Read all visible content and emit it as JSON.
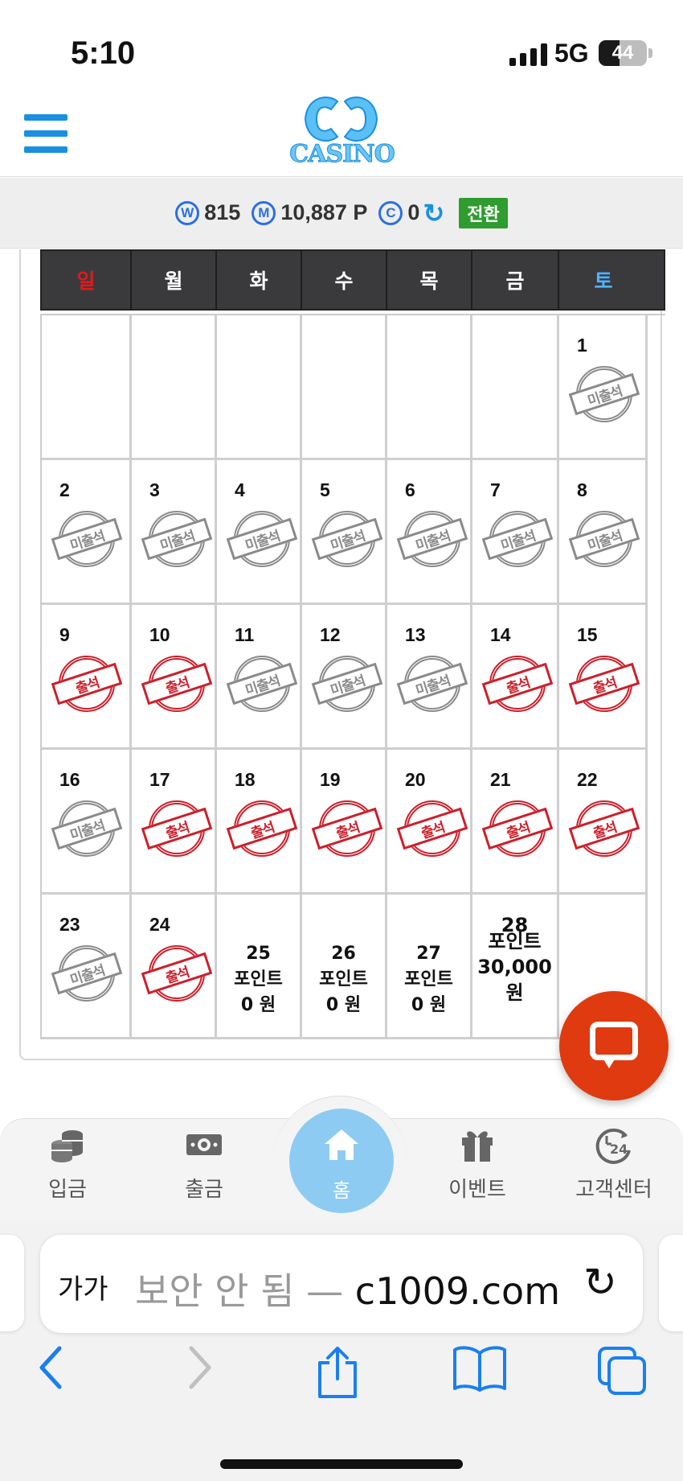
{
  "status_bar": {
    "time": "5:10",
    "network": "5G",
    "battery": "44",
    "battery_level": 0.44
  },
  "header": {
    "logo_text": "CASINO",
    "menu_icon": "hamburger-icon"
  },
  "balance": {
    "cash": "815",
    "mileage": "10,887 P",
    "coin": "0",
    "switch_label": "전환",
    "cash_icon": "W",
    "mileage_icon": "M",
    "coin_icon": "C"
  },
  "calendar": {
    "weekdays": [
      "일",
      "월",
      "화",
      "수",
      "목",
      "금",
      "토"
    ],
    "weekday_colors": [
      "#e01a1a",
      "#ffffff",
      "#ffffff",
      "#ffffff",
      "#ffffff",
      "#ffffff",
      "#4fb3ff"
    ],
    "stamp_absent": "미출석",
    "stamp_present": "출석",
    "points_label": "포인트",
    "days": [
      {
        "day": "",
        "status": ""
      },
      {
        "day": "",
        "status": ""
      },
      {
        "day": "",
        "status": ""
      },
      {
        "day": "",
        "status": ""
      },
      {
        "day": "",
        "status": ""
      },
      {
        "day": "",
        "status": ""
      },
      {
        "day": "1",
        "status": "absent"
      },
      {
        "day": "2",
        "status": "absent"
      },
      {
        "day": "3",
        "status": "absent"
      },
      {
        "day": "4",
        "status": "absent"
      },
      {
        "day": "5",
        "status": "absent"
      },
      {
        "day": "6",
        "status": "absent"
      },
      {
        "day": "7",
        "status": "absent"
      },
      {
        "day": "8",
        "status": "absent"
      },
      {
        "day": "9",
        "status": "present"
      },
      {
        "day": "10",
        "status": "present"
      },
      {
        "day": "11",
        "status": "absent"
      },
      {
        "day": "12",
        "status": "absent"
      },
      {
        "day": "13",
        "status": "absent"
      },
      {
        "day": "14",
        "status": "present"
      },
      {
        "day": "15",
        "status": "present"
      },
      {
        "day": "16",
        "status": "absent"
      },
      {
        "day": "17",
        "status": "present"
      },
      {
        "day": "18",
        "status": "present"
      },
      {
        "day": "19",
        "status": "present"
      },
      {
        "day": "20",
        "status": "present"
      },
      {
        "day": "21",
        "status": "present"
      },
      {
        "day": "22",
        "status": "present"
      },
      {
        "day": "23",
        "status": "absent"
      },
      {
        "day": "24",
        "status": "present"
      },
      {
        "day": "25",
        "status": "points",
        "amount": "0 원"
      },
      {
        "day": "26",
        "status": "points",
        "amount": "0 원"
      },
      {
        "day": "27",
        "status": "points",
        "amount": "0 원"
      },
      {
        "day": "28",
        "status": "points",
        "amount": "30,000",
        "unit": "원"
      },
      {
        "day": "",
        "status": ""
      }
    ]
  },
  "bottom_nav": {
    "items": [
      {
        "label": "입금",
        "icon": "coins-icon"
      },
      {
        "label": "출금",
        "icon": "cash-icon"
      },
      {
        "label": "홈",
        "icon": "home-icon"
      },
      {
        "label": "이벤트",
        "icon": "gift-icon"
      },
      {
        "label": "고객센터",
        "icon": "support-24-icon"
      }
    ]
  },
  "browser": {
    "aa_label": "가가",
    "url_prefix": "보안 안 됨 — ",
    "url_domain": "c1009.com"
  }
}
